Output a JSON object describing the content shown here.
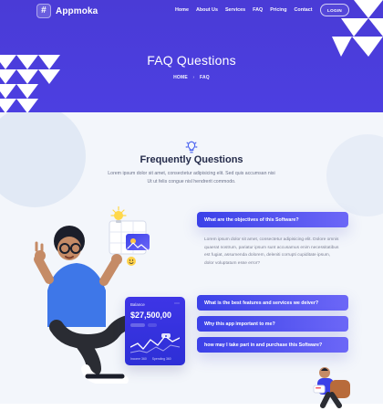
{
  "brand": {
    "name": "Appmoka",
    "logo_glyph": "#"
  },
  "nav": {
    "items": [
      "Home",
      "About Us",
      "Services",
      "FAQ",
      "Pricing",
      "Contact"
    ],
    "login_label": "LOGIN"
  },
  "hero": {
    "title": "FAQ Questions",
    "breadcrumb": {
      "home": "HOME",
      "current": "FAQ"
    }
  },
  "section": {
    "title": "Frequently Questions",
    "subtitle": "Lorem ipsum dolor sit amet, consectetur adipisicing elit. Sed quis accumsan nisi Ut ut felis congue nisl hendrerit commodo."
  },
  "balance_card": {
    "label": "Balance",
    "amount": "$27,500,00",
    "footer": [
      "Income 360",
      "Spending 360"
    ]
  },
  "faq": {
    "items": [
      {
        "question": "What are the objectives of this Software?"
      },
      {
        "answer": "Lorem ipsum dolor sit amet, consectetur adipisicing elit. Dolore omnis quaerat nostrum, pariatur ipsum sunt accusamus enim necessitatibus est fugiat, assumenda dolorem, deleniti corrupti cupiditate ipsum, dolor voluptatum esse error?"
      },
      {
        "question": "What is the best features and services we deiver?"
      },
      {
        "question": "Why this app important to me?"
      },
      {
        "question": "how may I take part in and purchase this Software?"
      }
    ]
  },
  "colors": {
    "brand": "#4A3BD6",
    "background": "#F3F6FB",
    "faq_gradient_start": "#3B41E8",
    "faq_gradient_end": "#6C67F7"
  }
}
